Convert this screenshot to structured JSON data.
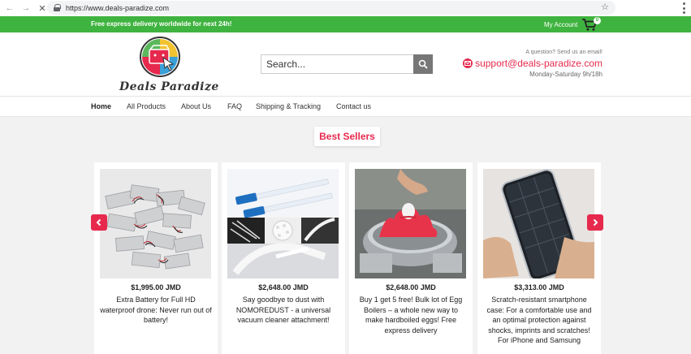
{
  "browser": {
    "url": "https://www.deals-paradize.com"
  },
  "topbar": {
    "promo": "Free express delivery worldwide for next 24h!",
    "account": "My Account",
    "cart_count": "0"
  },
  "header": {
    "logo_text": "Deals Paradize",
    "search_placeholder": "Search...",
    "question": "A question? Send us an email!",
    "email": "support@deals-paradize.com",
    "hours": "Monday-Saturday 9h/18h"
  },
  "nav": {
    "items": [
      {
        "label": "Home"
      },
      {
        "label": "All Products"
      },
      {
        "label": "About Us"
      },
      {
        "label": "FAQ"
      },
      {
        "label": "Shipping & Tracking"
      },
      {
        "label": "Contact us"
      }
    ]
  },
  "section_title": "Best Sellers",
  "products": [
    {
      "price": "$1,995.00 JMD",
      "title": "Extra Battery for Full HD waterproof drone: Never run out of battery!"
    },
    {
      "price": "$2,648.00 JMD",
      "title": "Say goodbye to dust with NOMOREDUST - a universal vacuum cleaner attachment!"
    },
    {
      "price": "$2,648.00 JMD",
      "title": "Buy 1 get 5 free! Bulk lot of Egg Boilers – a whole new way to make hardboiled eggs! Free express delivery"
    },
    {
      "price": "$3,313.00 JMD",
      "title": "Scratch-resistant smartphone case: For a comfortable use and an optimal protection against shocks, imprints and scratches! For iPhone and Samsung"
    }
  ],
  "colors": {
    "green": "#3fb33f",
    "accent": "#e6294d"
  }
}
